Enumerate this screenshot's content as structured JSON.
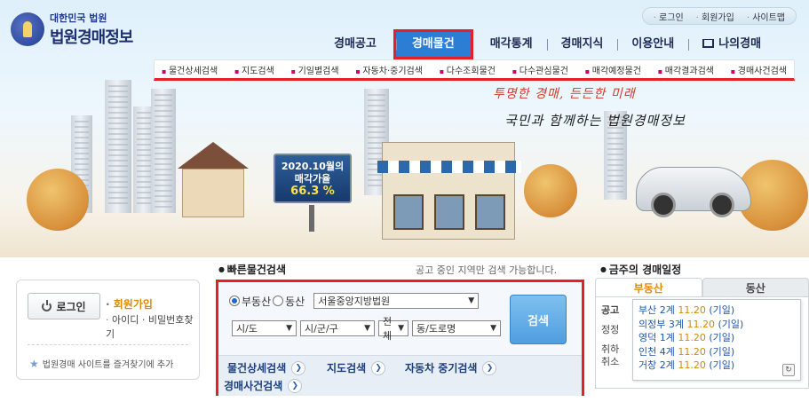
{
  "logo": {
    "sub": "대한민국 법원",
    "main": "법원경매정보"
  },
  "util_nav": [
    "로그인",
    "회원가입",
    "사이트맵"
  ],
  "gnb": [
    {
      "label": "경매공고",
      "active": false
    },
    {
      "label": "경매물건",
      "active": true
    },
    {
      "label": "매각통계",
      "active": false
    },
    {
      "label": "경매지식",
      "active": false
    },
    {
      "label": "이용안내",
      "active": false
    },
    {
      "label": "나의경매",
      "active": false
    }
  ],
  "subnav": [
    "물건상세검색",
    "지도검색",
    "기일별검색",
    "자동차·중기검색",
    "다수조회물건",
    "다수관심물건",
    "매각예정물건",
    "매각결과검색",
    "경매사건검색"
  ],
  "hero": {
    "slogan1": "투명한 경매, 든든한 미래",
    "slogan2": "국민과 함께하는 법원경매정보",
    "billboard_line1": "2020.10월의",
    "billboard_line2": "매각가율",
    "billboard_rate": "66.3 %"
  },
  "login": {
    "button": "로그인",
    "join": "회원가입",
    "find": "아이디 · 비밀번호찾기",
    "bookmark": "법원경매 사이트를 즐겨찾기에 추가"
  },
  "quick_search": {
    "title": "빠른물건검색",
    "note": "공고 중인 지역만 검색 가능합니다.",
    "radio_realty": "부동산",
    "radio_movable": "동산",
    "court": "서울중앙지방법원",
    "sido": "시/도",
    "sigungu": "시/군/구",
    "all": "전체",
    "dong": "동/도로명",
    "search_button": "검색",
    "links": [
      "물건상세검색",
      "지도검색",
      "자동차 중기검색",
      "경매사건검색"
    ]
  },
  "schedule": {
    "title": "금주의 경매일정",
    "tabs": [
      "부동산",
      "동산"
    ],
    "side": [
      "공고",
      "정정",
      "취하",
      "취소"
    ],
    "items": [
      {
        "court": "부산 2계",
        "date": "11.20",
        "type": "(기일)"
      },
      {
        "court": "의정부 3계",
        "date": "11.20",
        "type": "(기일)"
      },
      {
        "court": "영덕 1계",
        "date": "11.20",
        "type": "(기일)"
      },
      {
        "court": "인천 4계",
        "date": "11.20",
        "type": "(기일)"
      },
      {
        "court": "거창 2계",
        "date": "11.20",
        "type": "(기일)"
      }
    ]
  }
}
